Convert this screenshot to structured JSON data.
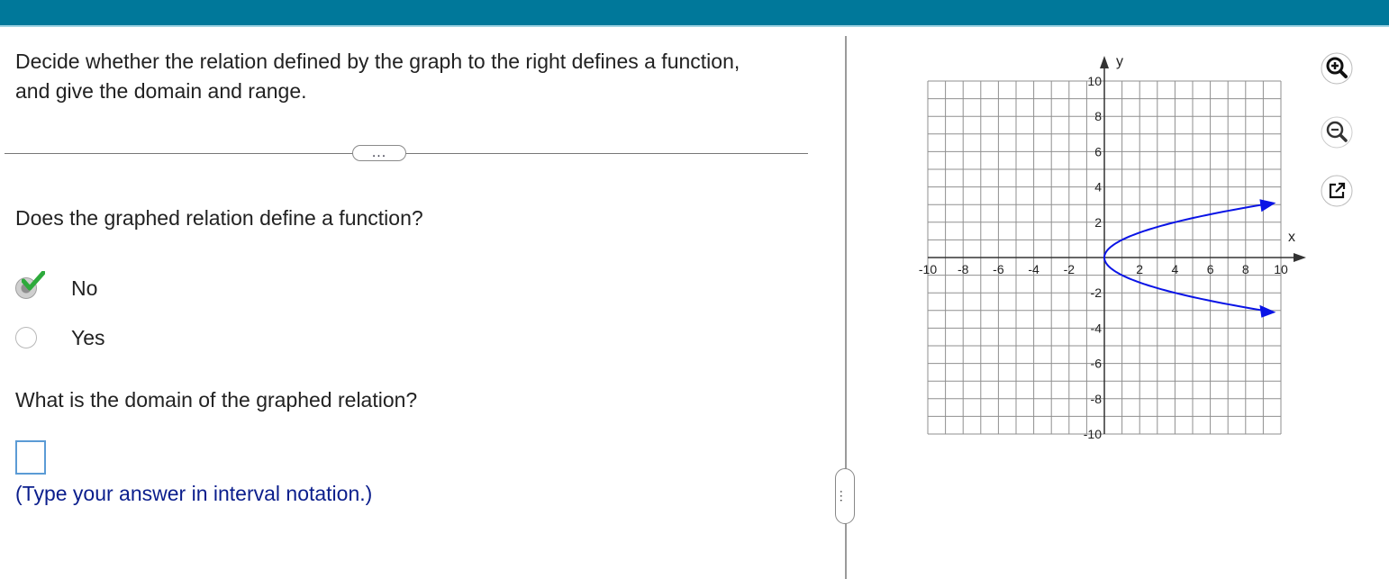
{
  "question": {
    "prompt": "Decide whether the relation defined by the graph to the right defines a function, and give the domain and range.",
    "more_button": "...",
    "q1": "Does the graphed relation define a function?",
    "options": [
      {
        "label": "No",
        "selected": true
      },
      {
        "label": "Yes",
        "selected": false
      }
    ],
    "q2": "What is the domain of the graphed relation?",
    "answer_value": "",
    "hint": "(Type your answer in interval notation.)"
  },
  "split_handle": "...",
  "graph": {
    "x_axis_label": "x",
    "y_axis_label": "y",
    "xlim": [
      -10,
      10
    ],
    "ylim": [
      -10,
      10
    ],
    "grid_step": 1,
    "x_ticks": [
      "-10",
      "-8",
      "-6",
      "-4",
      "-2",
      "2",
      "4",
      "6",
      "8",
      "10"
    ],
    "y_ticks": [
      "10",
      "8",
      "6",
      "4",
      "2",
      "-2",
      "-4",
      "-6",
      "-8",
      "-10"
    ],
    "curve": {
      "description_equation": "x = (y)^2 + 0",
      "vertex": [
        0,
        0
      ],
      "upper_end": [
        9,
        3
      ],
      "lower_end": [
        9,
        -3
      ],
      "color": "#0a14e6",
      "arrows_at_ends": true
    }
  },
  "tools": [
    {
      "icon": "zoom-in-icon"
    },
    {
      "icon": "zoom-out-icon"
    },
    {
      "icon": "popout-icon"
    }
  ],
  "colors": {
    "topbar": "#00789a",
    "curve": "#0a14e6",
    "hint": "#0b1e8c",
    "check": "#2eaa3c"
  }
}
